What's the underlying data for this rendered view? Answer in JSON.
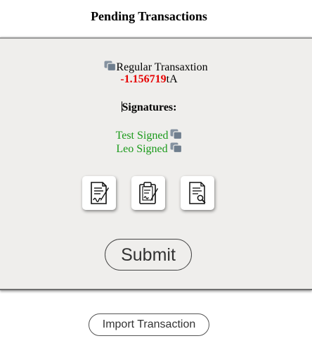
{
  "page": {
    "title": "Pending Transactions"
  },
  "transaction": {
    "name": "Regular Transaxtion",
    "amount": "-1.156719",
    "unit": "tA"
  },
  "signatures": {
    "heading": "Signatures:",
    "signers": [
      {
        "label": "Test Signed",
        "icon": "copy-icon"
      },
      {
        "label": "Leo Signed",
        "icon": "copy-icon"
      }
    ]
  },
  "tools": [
    {
      "icon": "sign-document-icon"
    },
    {
      "icon": "clipboard-sign-icon"
    },
    {
      "icon": "inspect-document-icon"
    }
  ],
  "actions": {
    "submit_label": "Submit",
    "import_label": "Import Transaction"
  },
  "colors": {
    "amount": "#e60000",
    "signed": "#1a9a1a",
    "panel_bg": "#efeeec",
    "icon": "#7a8896"
  }
}
